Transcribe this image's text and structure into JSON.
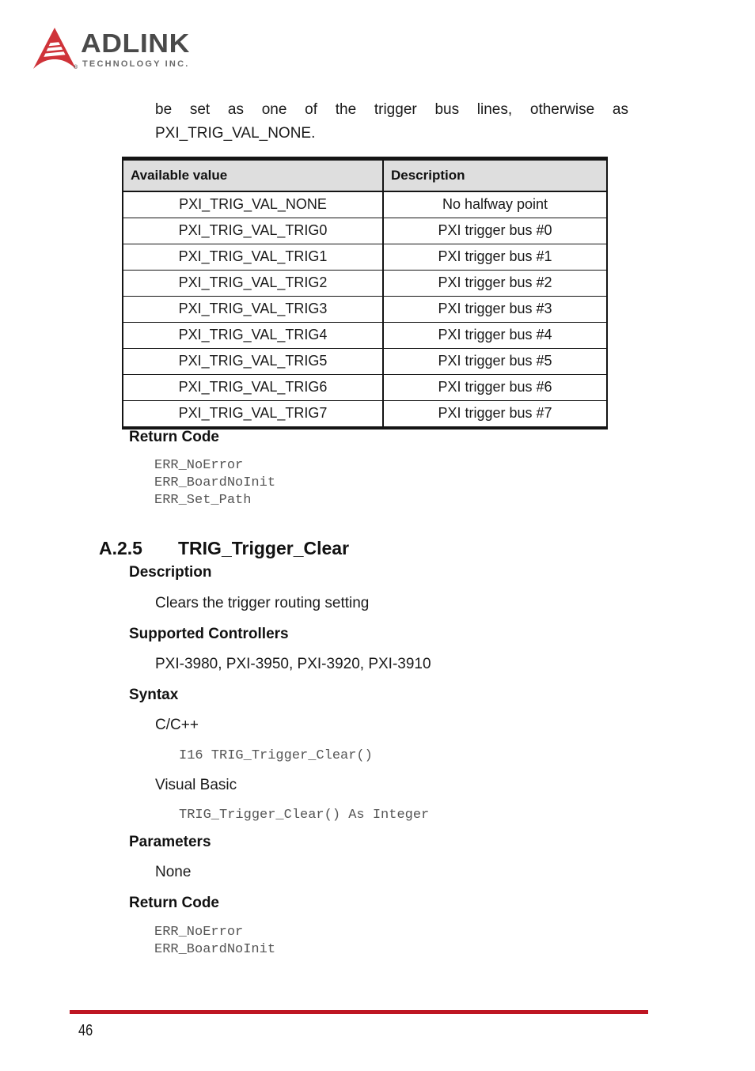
{
  "logo": {
    "wordmark": "ADLINK",
    "tagline": "TECHNOLOGY INC.",
    "registered_mark": "®",
    "mark_color": "#cf3339"
  },
  "intro": {
    "paragraph": "be set as one of the trigger bus lines, otherwise as PXI_TRIG_VAL_NONE."
  },
  "table": {
    "headers": [
      "Available value",
      "Description"
    ],
    "rows": [
      [
        "PXI_TRIG_VAL_NONE",
        "No halfway point"
      ],
      [
        "PXI_TRIG_VAL_TRIG0",
        "PXI trigger bus #0"
      ],
      [
        "PXI_TRIG_VAL_TRIG1",
        "PXI trigger bus #1"
      ],
      [
        "PXI_TRIG_VAL_TRIG2",
        "PXI trigger bus #2"
      ],
      [
        "PXI_TRIG_VAL_TRIG3",
        "PXI trigger bus #3"
      ],
      [
        "PXI_TRIG_VAL_TRIG4",
        "PXI trigger bus #4"
      ],
      [
        "PXI_TRIG_VAL_TRIG5",
        "PXI trigger bus #5"
      ],
      [
        "PXI_TRIG_VAL_TRIG6",
        "PXI trigger bus #6"
      ],
      [
        "PXI_TRIG_VAL_TRIG7",
        "PXI trigger bus #7"
      ]
    ]
  },
  "return_code_1": {
    "heading": "Return Code",
    "codes": "ERR_NoError\nERR_BoardNoInit\nERR_Set_Path"
  },
  "section": {
    "number": "A.2.5",
    "title": "TRIG_Trigger_Clear",
    "description_heading": "Description",
    "description_text": "Clears the trigger routing setting",
    "supported_heading": "Supported Controllers",
    "supported_text": "PXI-3980, PXI-3950, PXI-3920, PXI-3910",
    "syntax_heading": "Syntax",
    "syntax_lang_c": "C/C++",
    "syntax_code_c": "I16 TRIG_Trigger_Clear()",
    "syntax_lang_vb": "Visual Basic",
    "syntax_code_vb": "TRIG_Trigger_Clear() As Integer",
    "parameters_heading": "Parameters",
    "parameters_text": "None",
    "return_code_heading": "Return Code",
    "return_codes": "ERR_NoError\nERR_BoardNoInit"
  },
  "footer": {
    "page_number": "46",
    "rule_color": "#be1622"
  }
}
